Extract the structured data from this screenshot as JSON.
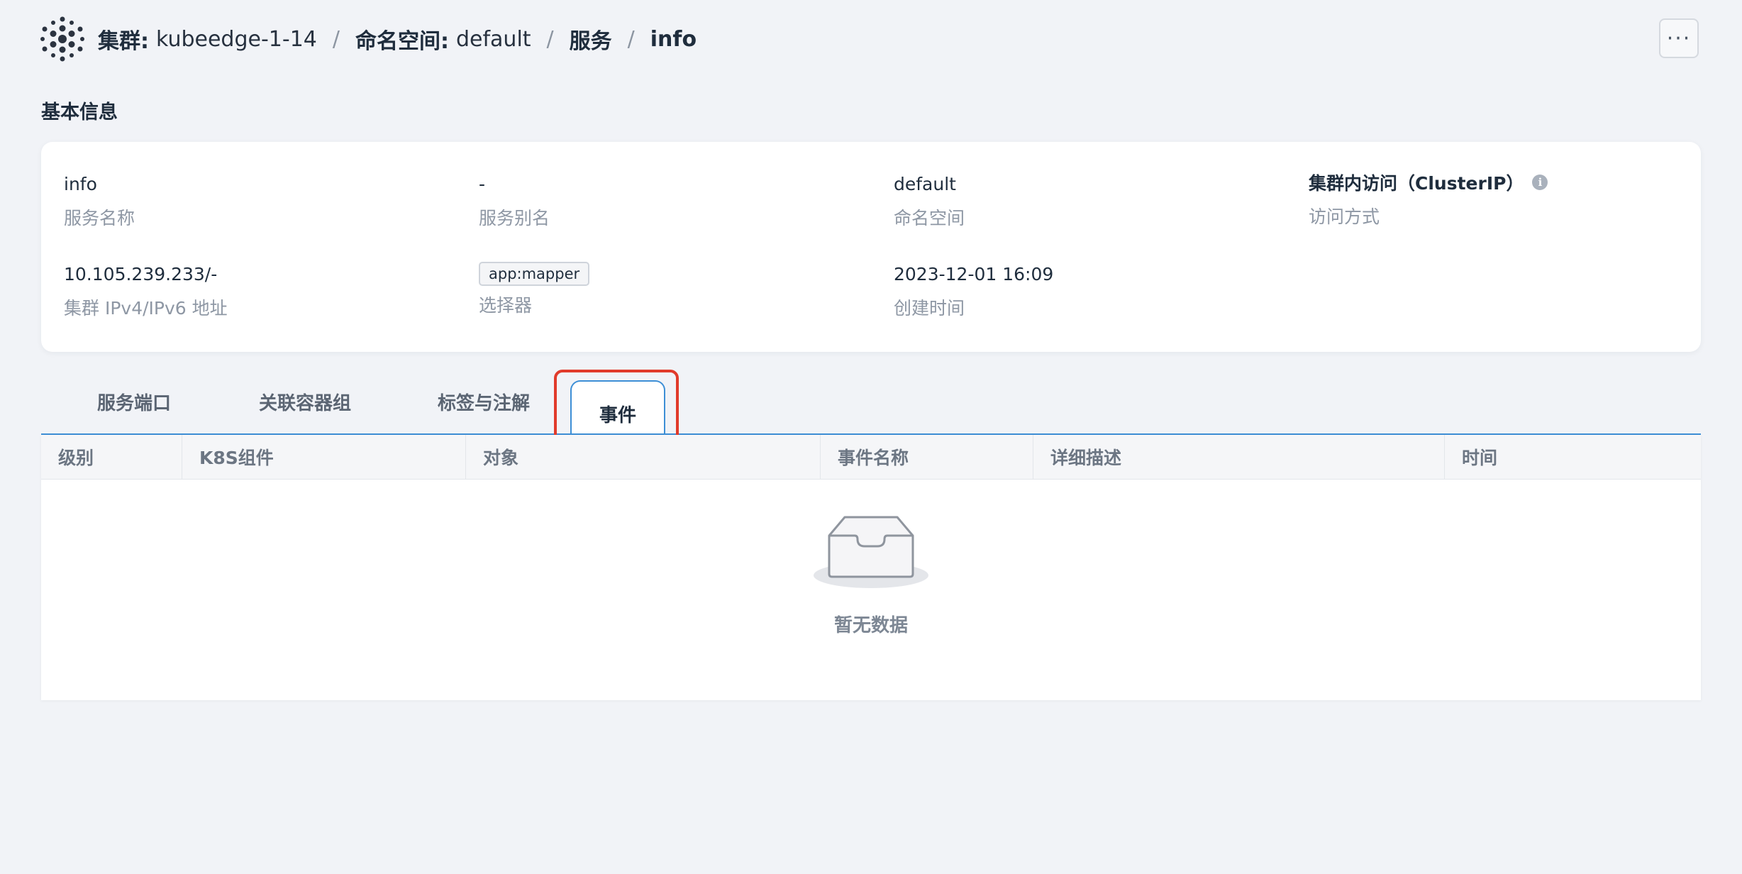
{
  "breadcrumb": {
    "cluster_key": "集群:",
    "cluster_value": "kubeedge-1-14",
    "namespace_key": "命名空间:",
    "namespace_value": "default",
    "service_link": "服务",
    "current": "info",
    "separator": "/"
  },
  "header": {
    "more_label": "···"
  },
  "basic_info": {
    "title": "基本信息",
    "items": [
      {
        "value": "info",
        "label": "服务名称"
      },
      {
        "value": "-",
        "label": "服务别名"
      },
      {
        "value": "default",
        "label": "命名空间"
      },
      {
        "value": "集群内访问（ClusterIP）",
        "label": "访问方式"
      },
      {
        "value": "10.105.239.233/-",
        "label": "集群 IPv4/IPv6 地址"
      },
      {
        "value": "app:mapper",
        "label": "选择器"
      },
      {
        "value": "2023-12-01 16:09",
        "label": "创建时间"
      }
    ],
    "info_icon": "info-icon"
  },
  "tabs": [
    {
      "label": "服务端口"
    },
    {
      "label": "关联容器组"
    },
    {
      "label": "标签与注解"
    },
    {
      "label": "事件"
    }
  ],
  "active_tab": "事件",
  "events_table": {
    "columns": [
      "级别",
      "K8S组件",
      "对象",
      "事件名称",
      "详细描述",
      "时间"
    ],
    "rows": [],
    "empty_text": "暂无数据"
  },
  "colors": {
    "accent": "#3d8fd6",
    "highlight": "#e13b2b",
    "background": "#f1f3f7"
  }
}
